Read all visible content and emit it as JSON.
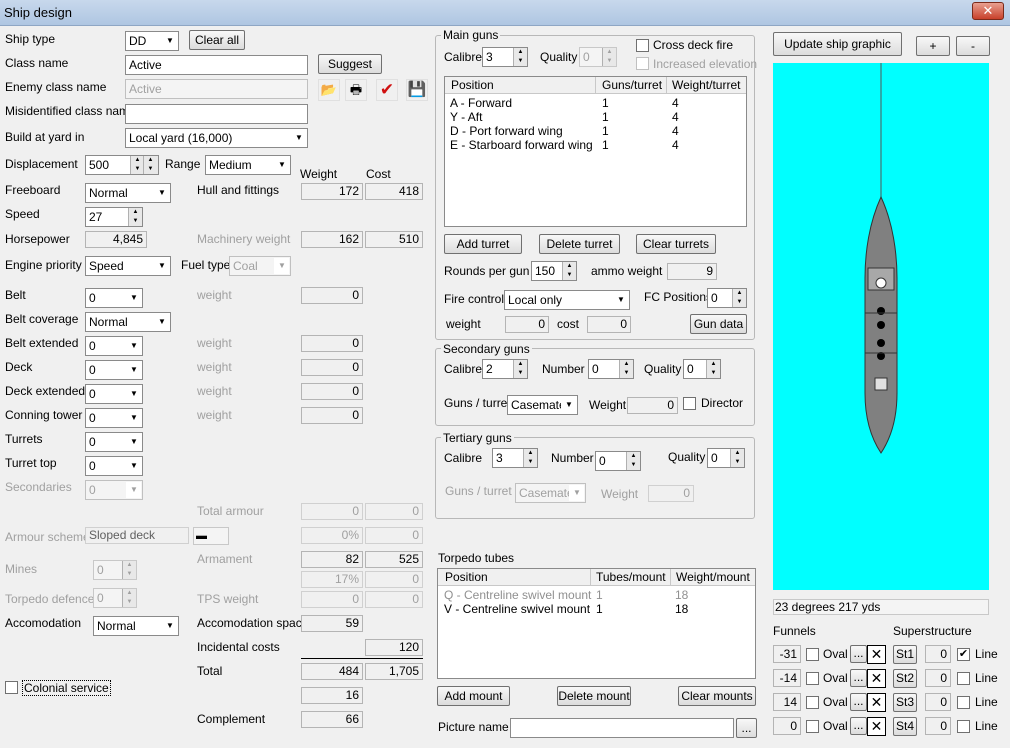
{
  "window": {
    "title": "Ship design",
    "close_label": "✕"
  },
  "general": {
    "ship_type_label": "Ship type",
    "ship_type": "DD",
    "clear_all": "Clear all",
    "class_name_label": "Class name",
    "class_name": "Active",
    "suggest": "Suggest",
    "enemy_class_label": "Enemy class name",
    "enemy_class": "Active",
    "misidentified_label": "Misidentified class name",
    "misidentified": "",
    "build_label": "Build at yard in",
    "build_yard": "Local yard (16,000)",
    "displacement_label": "Displacement",
    "displacement": "500",
    "range_label": "Range",
    "range": "Medium",
    "weight_hdr": "Weight",
    "cost_hdr": "Cost",
    "freeboard_label": "Freeboard",
    "freeboard": "Normal",
    "hull_label": "Hull and fittings",
    "hull_weight": "172",
    "hull_cost": "418",
    "speed_label": "Speed",
    "speed": "27",
    "hp_label": "Horsepower",
    "hp": "4,845",
    "mach_label": "Machinery weight",
    "mach_weight": "162",
    "mach_cost": "510",
    "engine_label": "Engine priority",
    "engine": "Speed",
    "fuel_label": "Fuel type",
    "fuel": "Coal"
  },
  "armour": {
    "belt_label": "Belt",
    "belt": "0",
    "belt_w_label": "weight",
    "belt_w": "0",
    "belt_cov_label": "Belt coverage",
    "belt_cov": "Normal",
    "belt_ext_label": "Belt extended",
    "belt_ext": "0",
    "belt_ext_w_label": "weight",
    "belt_ext_w": "0",
    "deck_label": "Deck",
    "deck": "0",
    "deck_w_label": "weight",
    "deck_w": "0",
    "deck_ext_label": "Deck extended",
    "deck_ext": "0",
    "deck_ext_w_label": "weight",
    "deck_ext_w": "0",
    "ct_label": "Conning tower",
    "ct": "0",
    "ct_w_label": "weight",
    "ct_w": "0",
    "turrets_label": "Turrets",
    "turrets": "0",
    "turret_top_label": "Turret top",
    "turret_top": "0",
    "secondaries_label": "Secondaries",
    "secondaries": "0",
    "total_armour_label": "Total armour",
    "total_armour_w": "0",
    "total_armour_c": "0",
    "scheme_label": "Armour scheme",
    "scheme": "Sloped deck",
    "scheme_pct": "0%",
    "scheme_c": "0",
    "armament_label": "Armament",
    "armament_w": "82",
    "armament_c": "525",
    "mines_label": "Mines",
    "mines": "0",
    "arm_pct": "17%",
    "arm_pct_c": "0",
    "torp_def_label": "Torpedo defence",
    "torp_def": "0",
    "tps_label": "TPS weight",
    "tps_w": "0",
    "tps_c": "0",
    "accom_label": "Accomodation",
    "accom": "Normal",
    "accom_space_label": "Accomodation space",
    "accom_space": "59",
    "incidental_label": "Incidental costs",
    "incidental": "120",
    "total_label": "Total",
    "total_w": "484",
    "total_c": "1,705",
    "extra": "16",
    "complement_label": "Complement",
    "complement": "66",
    "colonial_label": "Colonial service"
  },
  "main_guns": {
    "group": "Main guns",
    "calibre_label": "Calibre",
    "calibre": "3",
    "quality_label": "Quality",
    "quality": "0",
    "cross_deck": "Cross deck fire",
    "inc_elev": "Increased elevation",
    "columns": [
      "Position",
      "Guns/turret",
      "Weight/turret"
    ],
    "rows": [
      [
        "A - Forward",
        "1",
        "4"
      ],
      [
        "Y - Aft",
        "1",
        "4"
      ],
      [
        "D - Port forward wing",
        "1",
        "4"
      ],
      [
        "E - Starboard forward wing",
        "1",
        "4"
      ]
    ],
    "add": "Add turret",
    "delete": "Delete turret",
    "clear": "Clear turrets",
    "rounds_label": "Rounds per gun",
    "rounds": "150",
    "ammo_label": "ammo weight",
    "ammo": "9",
    "fire_label": "Fire control",
    "fire": "Local only",
    "fc_pos_label": "FC Positions",
    "fc_pos": "0",
    "fw_label": "weight",
    "fw": "0",
    "fc_label": "cost",
    "fc": "0",
    "gun_data": "Gun data"
  },
  "secondary": {
    "group": "Secondary guns",
    "calibre_label": "Calibre",
    "calibre": "2",
    "number_label": "Number",
    "number": "0",
    "quality_label": "Quality",
    "quality": "0",
    "gpt_label": "Guns / turret",
    "gpt": "Casemates",
    "weight_label": "Weight",
    "weight": "0",
    "director": "Director"
  },
  "tertiary": {
    "group": "Tertiary guns",
    "calibre_label": "Calibre",
    "calibre": "3",
    "number_label": "Number",
    "number": "0",
    "quality_label": "Quality",
    "quality": "0",
    "gpt_label": "Guns / turret",
    "gpt": "Casemates",
    "weight_label": "Weight",
    "weight": "0"
  },
  "torpedo": {
    "group": "Torpedo tubes",
    "columns": [
      "Position",
      "Tubes/mount",
      "Weight/mount"
    ],
    "rows": [
      [
        "Q - Centreline swivel mount",
        "1",
        "18"
      ],
      [
        "V - Centreline swivel mount",
        "1",
        "18"
      ]
    ],
    "add": "Add mount",
    "delete": "Delete mount",
    "clear": "Clear mounts"
  },
  "picture": {
    "label": "Picture name",
    "value": "",
    "browse": "..."
  },
  "graphic": {
    "update": "Update ship graphic",
    "plus": "+",
    "minus": "-",
    "status": "23 degrees 217 yds"
  },
  "funnels": {
    "label": "Funnels",
    "oval": "Oval",
    "dots": "...",
    "x": "✕",
    "rows": [
      {
        "v": "-31"
      },
      {
        "v": "-14"
      },
      {
        "v": "14"
      },
      {
        "v": "0"
      }
    ]
  },
  "superstructure": {
    "label": "Superstructure",
    "line": "Line",
    "rows": [
      {
        "btn": "St1",
        "v": "0",
        "line": true
      },
      {
        "btn": "St2",
        "v": "0",
        "line": false
      },
      {
        "btn": "St3",
        "v": "0",
        "line": false
      },
      {
        "btn": "St4",
        "v": "0",
        "line": false
      }
    ]
  },
  "colors": {
    "canvas": "#00ffff",
    "hull": "#808080"
  }
}
